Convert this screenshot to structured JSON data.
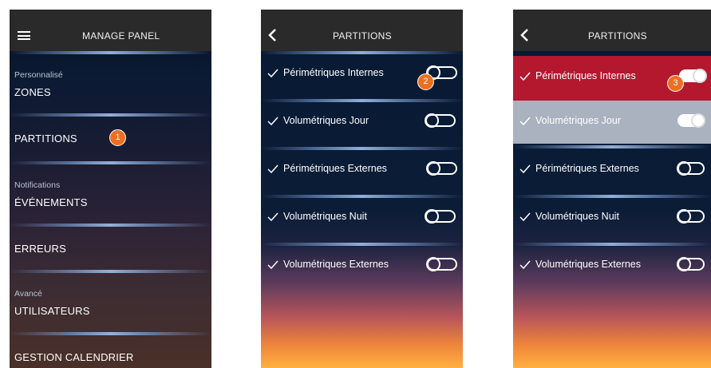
{
  "screens": [
    {
      "header_title": "MANAGE PANEL",
      "menu": [
        {
          "subtitle": "Personnalisé",
          "label": "ZONES"
        },
        {
          "subtitle": "",
          "label": "PARTITIONS"
        },
        {
          "subtitle": "Notifications",
          "label": "ÉVÉNEMENTS"
        },
        {
          "subtitle": "",
          "label": "ERREURS"
        },
        {
          "subtitle": "Avancé",
          "label": "UTILISATEURS"
        },
        {
          "subtitle": "",
          "label": "GESTION CALENDRIER"
        }
      ],
      "step_badge": "1"
    },
    {
      "header_title": "PARTITIONS",
      "partitions": [
        {
          "label": "Périmétriques Internes",
          "enabled": false
        },
        {
          "label": "Volumétriques Jour",
          "enabled": false
        },
        {
          "label": "Périmétriques Externes",
          "enabled": false
        },
        {
          "label": "Volumétriques Nuit",
          "enabled": false
        },
        {
          "label": "Volumétriques Externes",
          "enabled": false
        }
      ],
      "step_badge": "2"
    },
    {
      "header_title": "PARTITIONS",
      "partitions": [
        {
          "label": "Périmétriques Internes",
          "enabled": true,
          "highlight": "#b3182f"
        },
        {
          "label": "Volumétriques Jour",
          "enabled": true,
          "highlight": "#aab2c0"
        },
        {
          "label": "Périmétriques Externes",
          "enabled": false
        },
        {
          "label": "Volumétriques Nuit",
          "enabled": false
        },
        {
          "label": "Volumétriques Externes",
          "enabled": false
        }
      ],
      "step_badge": "3"
    }
  ],
  "colors": {
    "topbar": "#2a2a2a",
    "badge": "#ee6e22",
    "active_row": "#b3182f",
    "selected_row": "#aab2c0"
  },
  "icons": {
    "menu": "hamburger-icon",
    "back": "chevron-left-icon",
    "check": "checkmark-icon"
  }
}
